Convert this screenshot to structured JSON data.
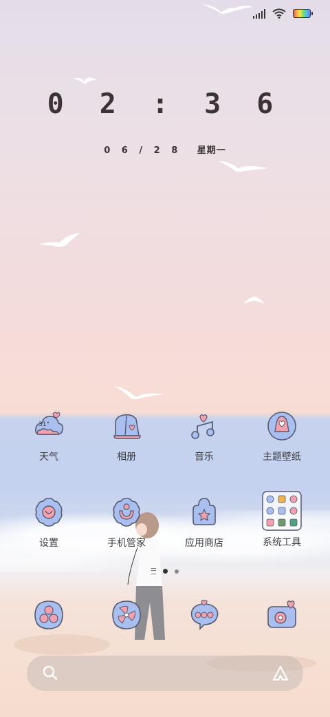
{
  "status_bar": {
    "signal_icon": "cellular-signal-icon",
    "wifi_icon": "wifi-icon",
    "battery_icon": "battery-icon"
  },
  "lock_clock": {
    "time": "0 2 : 3 6",
    "date": "0 6 / 2 8",
    "weekday": "星期一"
  },
  "apps_row1": [
    {
      "label": "天气",
      "icon": "weather-icon",
      "badge": "31°"
    },
    {
      "label": "相册",
      "icon": "gallery-icon"
    },
    {
      "label": "音乐",
      "icon": "music-icon"
    },
    {
      "label": "主题壁纸",
      "icon": "themes-icon"
    }
  ],
  "apps_row2": [
    {
      "label": "设置",
      "icon": "settings-icon"
    },
    {
      "label": "手机管家",
      "icon": "security-icon"
    },
    {
      "label": "应用商店",
      "icon": "app-store-icon"
    },
    {
      "label": "系统工具",
      "icon": "system-tools-folder-icon"
    }
  ],
  "dock": [
    {
      "icon": "phone-icon"
    },
    {
      "icon": "browser-icon"
    },
    {
      "icon": "messages-icon"
    },
    {
      "icon": "camera-icon"
    }
  ],
  "page_indicator": {
    "pages": 2,
    "active": 1
  },
  "search": {
    "placeholder": ""
  },
  "colors": {
    "icon_fill": "#a9bff0",
    "icon_accent": "#f3a1ae",
    "icon_stroke": "#555a70",
    "text": "#3d3d45"
  }
}
